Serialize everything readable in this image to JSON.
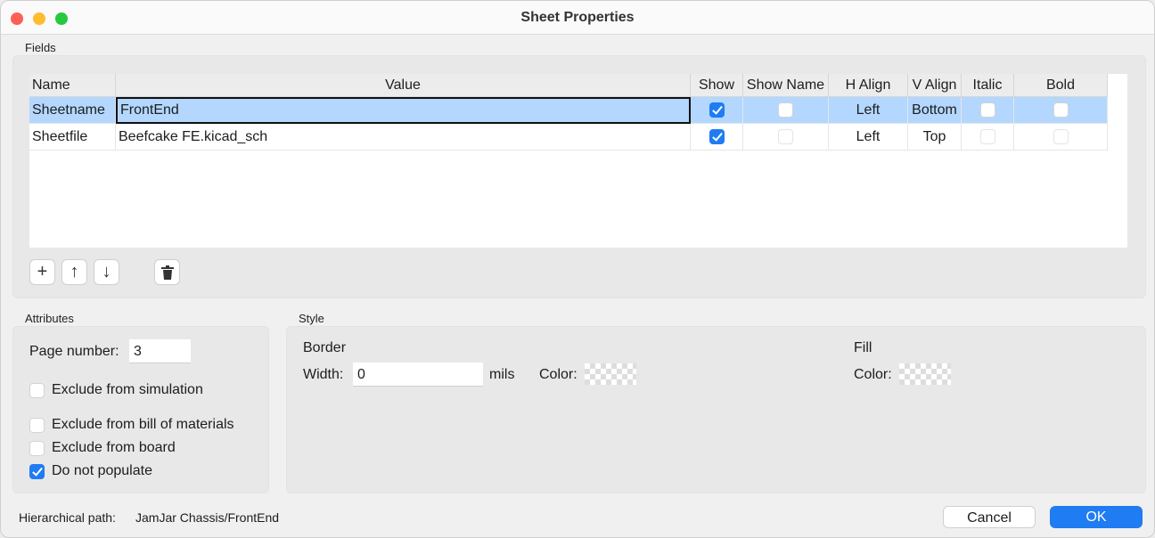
{
  "window": {
    "title": "Sheet Properties"
  },
  "fields": {
    "group_label": "Fields",
    "columns": [
      "Name",
      "Value",
      "Show",
      "Show Name",
      "H Align",
      "V Align",
      "Italic",
      "Bold"
    ],
    "rows": [
      {
        "name": "Sheetname",
        "value": "FrontEnd",
        "show": true,
        "show_name": false,
        "h_align": "Left",
        "v_align": "Bottom",
        "italic": false,
        "bold": false,
        "selected": true
      },
      {
        "name": "Sheetfile",
        "value": "Beefcake FE.kicad_sch",
        "show": true,
        "show_name": false,
        "h_align": "Left",
        "v_align": "Top",
        "italic": false,
        "bold": false,
        "selected": false
      }
    ],
    "toolbar_icons": [
      "plus-icon",
      "arrow-up-icon",
      "arrow-down-icon",
      "trash-icon"
    ]
  },
  "attributes": {
    "group_label": "Attributes",
    "page_number_label": "Page number:",
    "page_number": "3",
    "exclude_sim": {
      "label": "Exclude from simulation",
      "checked": false
    },
    "exclude_bom": {
      "label": "Exclude from bill of materials",
      "checked": false
    },
    "exclude_board": {
      "label": "Exclude from board",
      "checked": false
    },
    "dnp": {
      "label": "Do not populate",
      "checked": true
    }
  },
  "style": {
    "group_label": "Style",
    "border_label": "Border",
    "width_label": "Width:",
    "width_value": "0",
    "units": "mils",
    "border_color_label": "Color:",
    "fill_label": "Fill",
    "fill_color_label": "Color:"
  },
  "footer": {
    "path_label": "Hierarchical path:",
    "path_value": "JamJar Chassis/FrontEnd",
    "cancel": "Cancel",
    "ok": "OK"
  },
  "colors": {
    "accent": "#1f7cf2",
    "selection": "#b3d7ff"
  }
}
